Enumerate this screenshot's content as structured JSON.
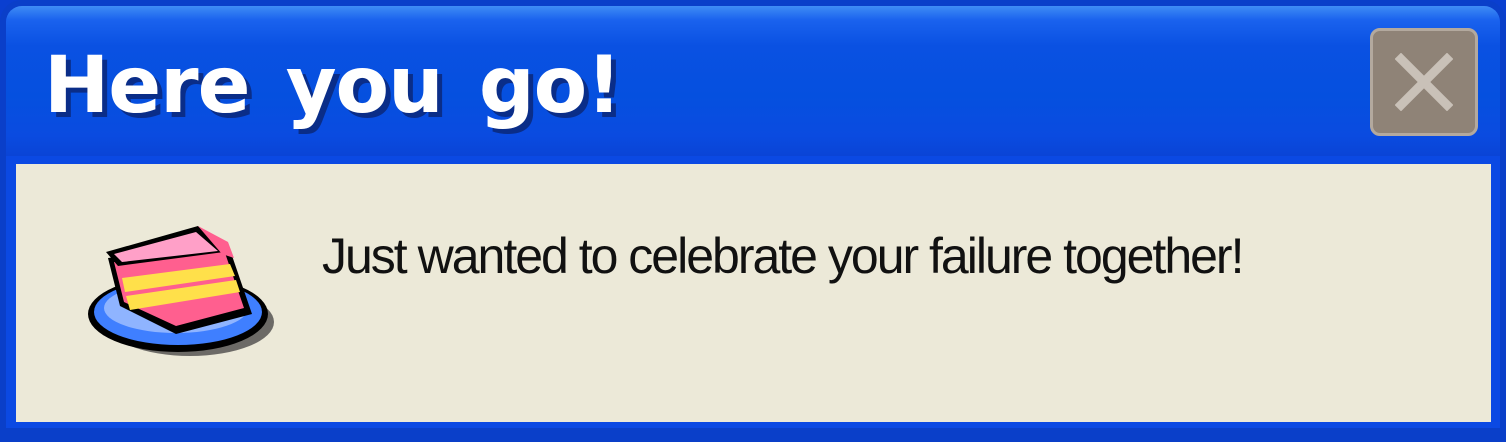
{
  "dialog": {
    "title": "Here you go!",
    "message": "Just wanted to celebrate your failure together!",
    "icon": "cake-icon",
    "close_icon": "close-icon"
  },
  "colors": {
    "titlebar": "#0550df",
    "body": "#ece9d8",
    "close_button": "#8f8377",
    "title_text": "#ffffff",
    "message_text": "#111111"
  }
}
